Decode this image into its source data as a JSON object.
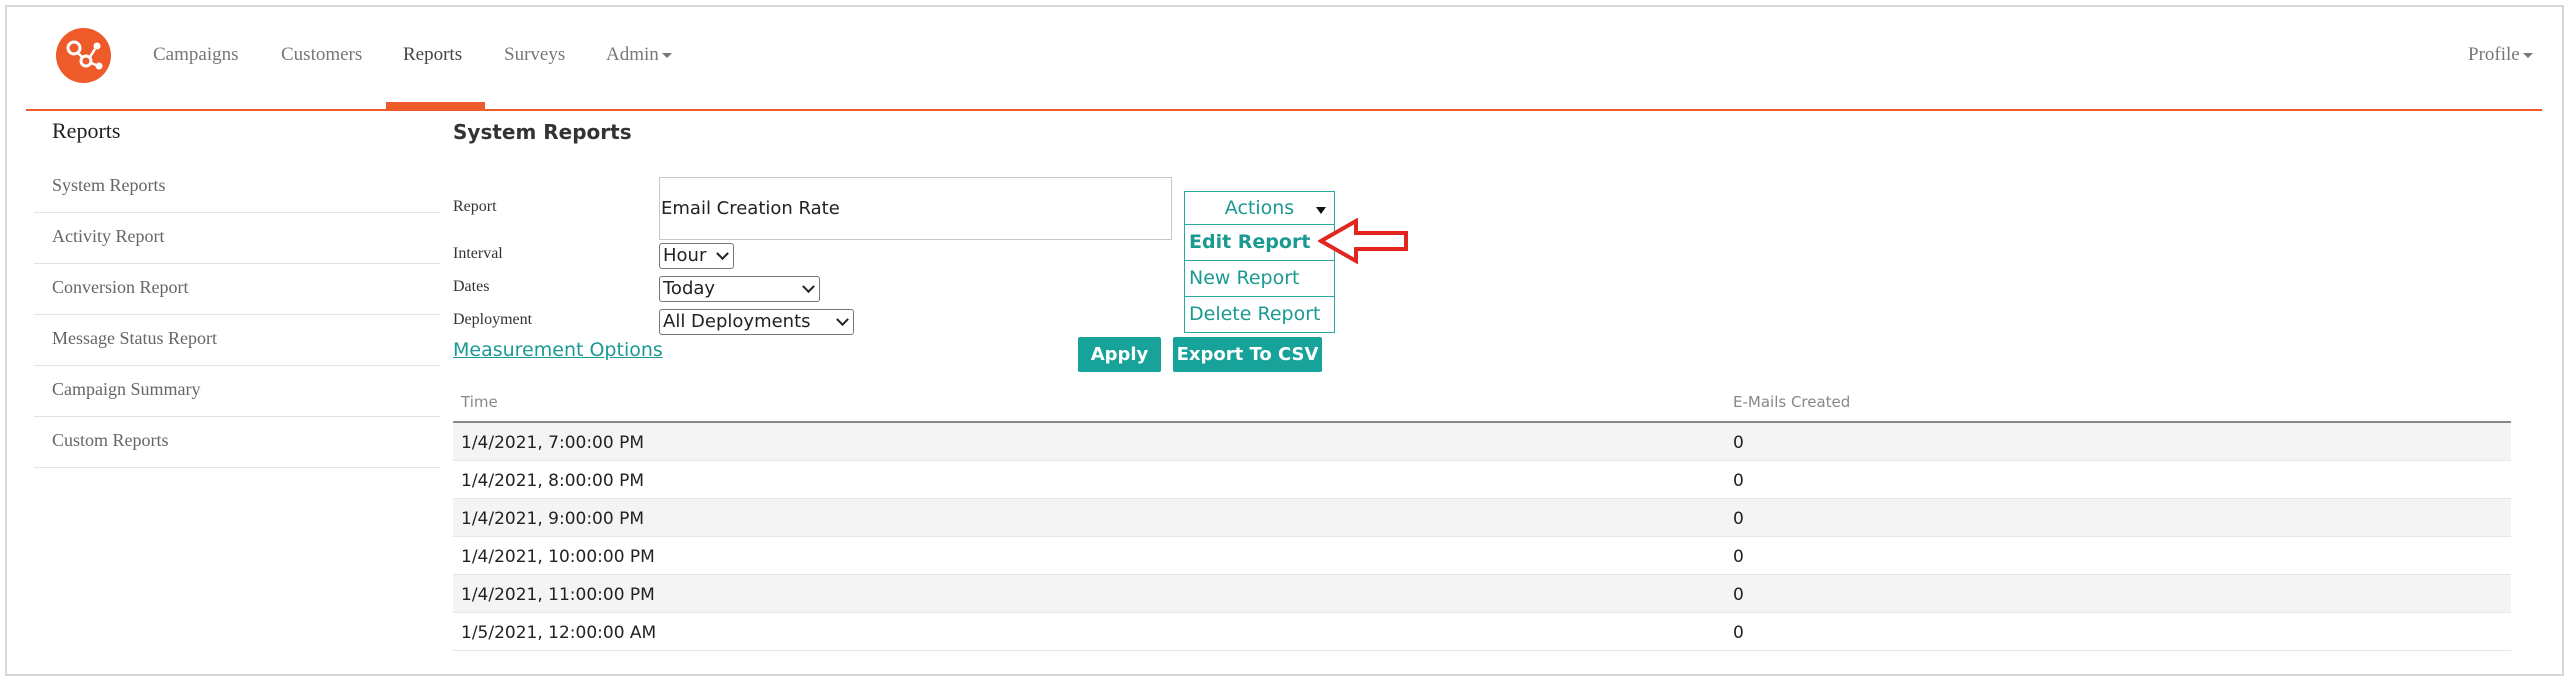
{
  "nav": {
    "items": [
      "Campaigns",
      "Customers",
      "Reports",
      "Surveys",
      "Admin"
    ],
    "active": "Reports",
    "profile": "Profile"
  },
  "sidebar": {
    "title": "Reports",
    "items": [
      "System Reports",
      "Activity Report",
      "Conversion Report",
      "Message Status Report",
      "Campaign Summary",
      "Custom Reports"
    ]
  },
  "main": {
    "title": "System Reports",
    "form": {
      "report_label": "Report",
      "report_value": "Email Creation Rate",
      "interval_label": "Interval",
      "interval_value": "Hour",
      "dates_label": "Dates",
      "dates_value": "Today",
      "deployment_label": "Deployment",
      "deployment_value": "All Deployments"
    },
    "actions": {
      "label": "Actions",
      "menu": [
        "Edit Report",
        "New Report",
        "Delete Report"
      ],
      "highlight_color": "#e0261f"
    },
    "measurement_link": "Measurement Options",
    "apply_label": "Apply",
    "export_label": "Export To CSV"
  },
  "table": {
    "columns": [
      "Time",
      "E-Mails Created"
    ],
    "rows": [
      [
        "1/4/2021, 7:00:00 PM",
        "0"
      ],
      [
        "1/4/2021, 8:00:00 PM",
        "0"
      ],
      [
        "1/4/2021, 9:00:00 PM",
        "0"
      ],
      [
        "1/4/2021, 10:00:00 PM",
        "0"
      ],
      [
        "1/4/2021, 11:00:00 PM",
        "0"
      ],
      [
        "1/5/2021, 12:00:00 AM",
        "0"
      ]
    ]
  },
  "colors": {
    "brand": "#ef5a2a",
    "accent": "#17a39a"
  }
}
